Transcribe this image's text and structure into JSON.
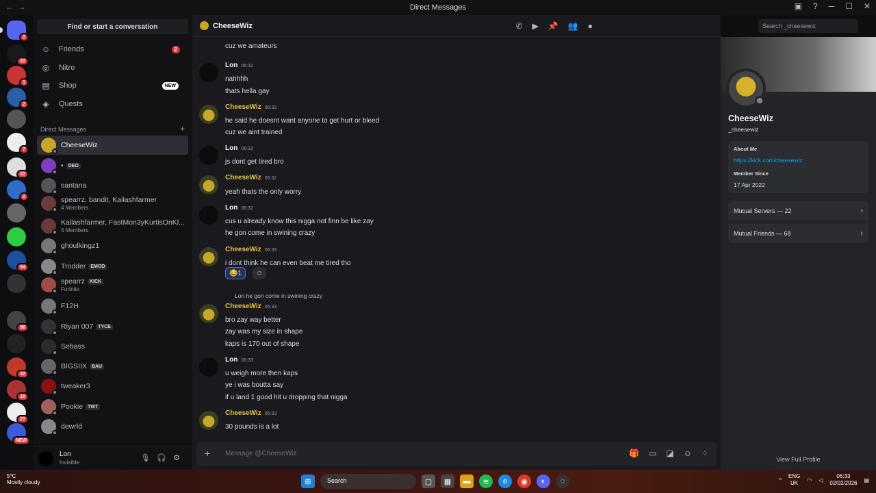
{
  "window": {
    "title": "Direct Messages"
  },
  "sidebar": {
    "find_placeholder": "Find or start a conversation",
    "nav": [
      {
        "label": "Friends",
        "badge": "2",
        "icon": "friends-icon"
      },
      {
        "label": "Nitro",
        "badge": "",
        "icon": "nitro-icon"
      },
      {
        "label": "Shop",
        "badge": "NEW",
        "icon": "shop-icon"
      },
      {
        "label": "Quests",
        "badge": "",
        "icon": "quests-icon"
      }
    ],
    "dm_header": "Direct Messages",
    "dms": [
      {
        "name": "CheeseWiz",
        "tag": "",
        "sub": "",
        "color": "#c8a628",
        "active": true
      },
      {
        "name": "•",
        "tag": "DEO",
        "sub": "",
        "color": "#7b3fbf"
      },
      {
        "name": "santana",
        "tag": "",
        "sub": "",
        "color": "#555"
      },
      {
        "name": "spearrz, bandit, Kailashfarmer",
        "tag": "",
        "sub": "4 Members",
        "color": "#6b3a3a"
      },
      {
        "name": "Kailashfarmer, FastMon3yKurtisOnKl...",
        "tag": "",
        "sub": "4 Members",
        "color": "#6b3a3a"
      },
      {
        "name": "ghoulkingz1",
        "tag": "",
        "sub": "",
        "color": "#777"
      },
      {
        "name": "Trodder",
        "tag": "EMOD",
        "sub": "",
        "color": "#888"
      },
      {
        "name": "spearrz",
        "tag": "KICK",
        "sub": "Fortnite",
        "color": "#a04a4a"
      },
      {
        "name": "F12H",
        "tag": "",
        "sub": "",
        "color": "#777"
      },
      {
        "name": "Riyan 007",
        "tag": "TYCE",
        "sub": "",
        "color": "#333"
      },
      {
        "name": "Sebass",
        "tag": "",
        "sub": "",
        "color": "#2b2b2b"
      },
      {
        "name": "BIGSIIX",
        "tag": "BAU",
        "sub": "",
        "color": "#666"
      },
      {
        "name": "tweaker3",
        "tag": "",
        "sub": "",
        "color": "#8a1010"
      },
      {
        "name": "Pookie",
        "tag": "TWT",
        "sub": "",
        "color": "#a06060"
      },
      {
        "name": "dewrld",
        "tag": "",
        "sub": "",
        "color": "#888"
      }
    ]
  },
  "servers": [
    {
      "badge": "2",
      "color": "#5865f2"
    },
    {
      "badge": "22",
      "color": "#1a1a1a"
    },
    {
      "badge": "1",
      "color": "#c33"
    },
    {
      "badge": "2",
      "color": "#2a5fa8"
    },
    {
      "badge": "",
      "color": "#555"
    },
    {
      "badge": "7",
      "color": "#eee"
    },
    {
      "badge": "22",
      "color": "#ddd"
    },
    {
      "badge": "2",
      "color": "#2f6dc9"
    },
    {
      "badge": "",
      "color": "#666"
    },
    {
      "badge": "",
      "color": "#2ecc40"
    },
    {
      "badge": "64",
      "color": "#1f4fa0"
    },
    {
      "badge": "",
      "color": "#333"
    },
    {
      "badge": "98",
      "color": "#444"
    },
    {
      "badge": "",
      "color": "#222"
    },
    {
      "badge": "32",
      "color": "#c0392b"
    },
    {
      "badge": "10",
      "color": "#a33"
    },
    {
      "badge": "27",
      "color": "#eee"
    },
    {
      "badge": "NEW",
      "color": "#3b5bdb"
    }
  ],
  "user": {
    "name": "Lon",
    "status": "Invisible"
  },
  "chat": {
    "recipient": "CheeseWiz",
    "search_placeholder": "Search _cheesewiz",
    "composer_placeholder": "Message @CheeseWiz",
    "top_line": "cuz we amateurs",
    "messages": [
      {
        "author": "Lon",
        "time": "06:32",
        "lines": [
          "nahhhh",
          "thats hella gay"
        ]
      },
      {
        "author": "CheeseWiz",
        "time": "06:32",
        "lines": [
          "he said he doesnt want anyone to get hurt or bleed",
          "cuz we aint trained"
        ]
      },
      {
        "author": "Lon",
        "time": "06:32",
        "lines": [
          "js dont get tired bro"
        ]
      },
      {
        "author": "CheeseWiz",
        "time": "06:32",
        "lines": [
          "yeah thats the only worry"
        ]
      },
      {
        "author": "Lon",
        "time": "06:32",
        "lines": [
          "cus u already know this nigga not finn be like zay",
          "he gon come in swining crazy"
        ]
      },
      {
        "author": "CheeseWiz",
        "time": "06:33",
        "lines": [
          "i dont think he can even beat me tired tho"
        ]
      },
      {
        "author": "CheeseWiz",
        "time": "06:33",
        "lines": [
          "bro zay way better",
          "zay was my size in shape",
          "kaps is 170 out of shape"
        ]
      },
      {
        "author": "Lon",
        "time": "06:33",
        "lines": [
          "u weigh more then kaps",
          "ye i was boutta say",
          "if u land 1 good hit u dropping that nigga"
        ]
      },
      {
        "author": "CheeseWiz",
        "time": "06:33",
        "lines": [
          "30 pounds is a lot"
        ]
      }
    ],
    "reaction_count": "1",
    "reply_author": "Lon",
    "reply_text": "he gon come in swining crazy"
  },
  "profile": {
    "display_name": "CheeseWiz",
    "username": "_cheesewiz",
    "about_label": "About Me",
    "about_link": "https://kick.com/cheesewiz",
    "since_label": "Member Since",
    "since_value": "17 Apr 2022",
    "mutual_servers": "Mutual Servers — 22",
    "mutual_friends": "Mutual Friends — 68",
    "view_full": "View Full Profile"
  },
  "taskbar": {
    "weather_temp": "5°C",
    "weather_desc": "Mostly cloudy",
    "search": "Search",
    "lang_top": "ENG",
    "lang_bottom": "UK",
    "time": "06:33",
    "date": "02/02/2026"
  },
  "colors": {
    "accent": "#5865f2",
    "link": "#00a8fc",
    "cheesewiz_name": "#e6c445",
    "lon_name": "#f2f3f5",
    "badge": "#da373c"
  }
}
